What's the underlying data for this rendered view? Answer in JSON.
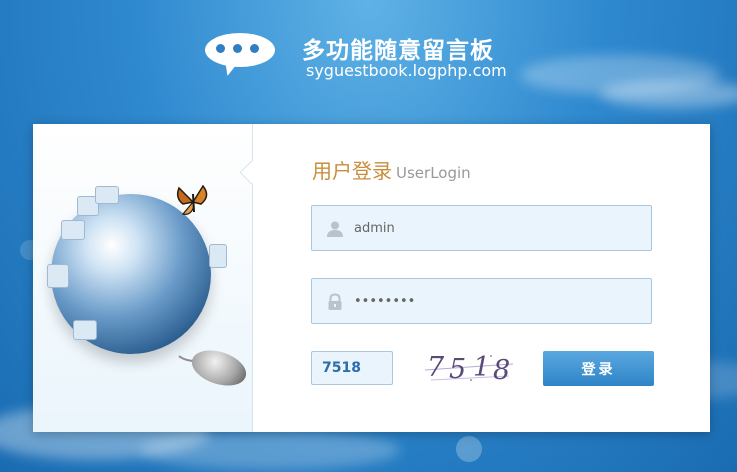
{
  "header": {
    "title": "多功能随意留言板",
    "domain": "syguestbook.logphp.com"
  },
  "login": {
    "title_cn": "用户登录",
    "title_en": "UserLogin",
    "username_value": "admin",
    "password_value": "••••••••",
    "captcha_value": "7518",
    "captcha_image_text": [
      "7",
      "5",
      "1",
      "8"
    ],
    "submit_label": "登录"
  },
  "icons": {
    "logo": "chat-bubble-icon",
    "user_field": "user-icon",
    "password_field": "lock-icon"
  },
  "colors": {
    "background": "#2f89cf",
    "title_accent": "#c98e3d",
    "button": "#2f84c6",
    "input_bg": "#e9f4fc"
  }
}
